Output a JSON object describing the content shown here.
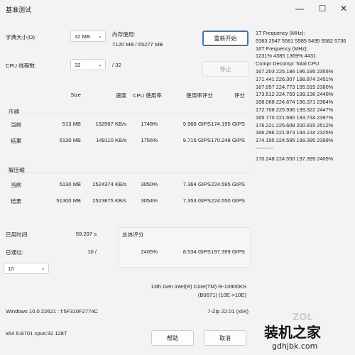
{
  "window": {
    "title": "基准测试",
    "minimize": "—",
    "maximize": "☐",
    "close": "✕"
  },
  "controls": {
    "dict_label": "字典大小(D):",
    "dict_value": "32 MB",
    "threads_label": "CPU 线程数:",
    "threads_value": "32",
    "threads_total": "/ 32",
    "memory_label": "内存使用:",
    "memory_value": "7120 MB / 65277 MB",
    "restart_button": "重新开始",
    "stop_button": "停止"
  },
  "table": {
    "headers": [
      "Size",
      "速度",
      "CPU 使用率",
      "使用率评分",
      "评分"
    ],
    "compress_label": "压缩",
    "compress_rows": [
      {
        "label": "当前",
        "cells": [
          "513 MB",
          "152567 KB/s",
          "1748%",
          "9.968 GIPS",
          "174.195 GIPS"
        ]
      },
      {
        "label": "结果",
        "cells": [
          "5130 MB",
          "149110 KB/s",
          "1756%",
          "9.715 GIPS",
          "170.248 GIPS"
        ]
      }
    ],
    "decompress_label": "解压缩",
    "decompress_rows": [
      {
        "label": "当前",
        "cells": [
          "5130 MB",
          "2524374 KB/s",
          "3050%",
          "7.364 GIPS",
          "224.595 GIPS"
        ]
      },
      {
        "label": "结果",
        "cells": [
          "51300 MB",
          "2523875 KB/s",
          "3054%",
          "7.353 GIPS",
          "224.550 GIPS"
        ]
      }
    ]
  },
  "stats": {
    "elapsed_label": "已用时间:",
    "elapsed_value": "59.297 s",
    "passes_label": "已通过:",
    "passes_value": "10 /",
    "passes_select": "10",
    "summary_label": "总体评分",
    "summary_values": [
      "2405%",
      "8.534 GIPS",
      "197.399 GIPS"
    ]
  },
  "right_panel": {
    "lines": [
      "1T Frequency (MHz):",
      " 5383 2547 5581 5585 5495 5582 5736",
      "16T Frequency (MHz):",
      " 1231% 4385 1369% 4431",
      "Compr Decompr Total  CPU",
      "167.203  225.186  196.195  2355%",
      "171.441  226.307  198.874  2451%",
      "167.057  224.773  195.915  2360%",
      "173.512  224.759  199.136  2440%",
      "168.068  224.674  196.371  2364%",
      "172.708  225.936  199.322  2447%",
      "165.770  221.690  193.734  2397%",
      "176.221  225.608  200.915  2512%",
      "166.296  221.973  194.134  2325%",
      "174.195  224.595  199.395  2399%",
      "----------",
      "170.248  224.550  197.399  2405%"
    ]
  },
  "system": {
    "cpu_line1": "13th Gen Intel(R) Core(TM) i9-13900KS",
    "cpu_line2": "(B0671) (10E->10E)",
    "os": "Windows 10.0 22621 : f:5F310F2774C",
    "zip": "7-Zip 22.01 (x64)",
    "arch": "x64 6.B701 cpus:32 128T",
    "help_button": "帮助",
    "cancel_button": "取消"
  },
  "watermark": {
    "logo": "装机之家",
    "url": "gdhjbk.com",
    "badge": "ZOL"
  }
}
